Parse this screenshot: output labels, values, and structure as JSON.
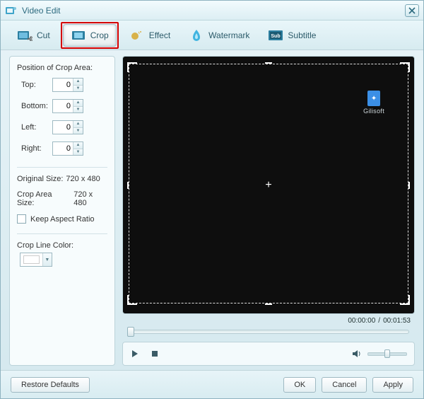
{
  "window": {
    "title": "Video Edit"
  },
  "tabs": {
    "cut": "Cut",
    "crop": "Crop",
    "effect": "Effect",
    "watermark": "Watermark",
    "subtitle": "Subtitle",
    "active": "crop"
  },
  "crop": {
    "heading": "Position of Crop Area:",
    "fields": {
      "top": {
        "label": "Top:",
        "value": "0"
      },
      "bottom": {
        "label": "Bottom:",
        "value": "0"
      },
      "left": {
        "label": "Left:",
        "value": "0"
      },
      "right": {
        "label": "Right:",
        "value": "0"
      }
    },
    "original_size_label": "Original Size:",
    "original_size_value": "720 x 480",
    "crop_area_label": "Crop Area Size:",
    "crop_area_value": "720 x 480",
    "keep_aspect_label": "Keep Aspect Ratio",
    "keep_aspect_checked": false,
    "crop_line_color_label": "Crop Line Color:",
    "crop_line_color": "#ffffff"
  },
  "preview": {
    "watermark_text": "Gilisoft",
    "time_current": "00:00:00",
    "time_separator": "/",
    "time_total": "00:01:53"
  },
  "footer": {
    "restore": "Restore Defaults",
    "ok": "OK",
    "cancel": "Cancel",
    "apply": "Apply"
  }
}
